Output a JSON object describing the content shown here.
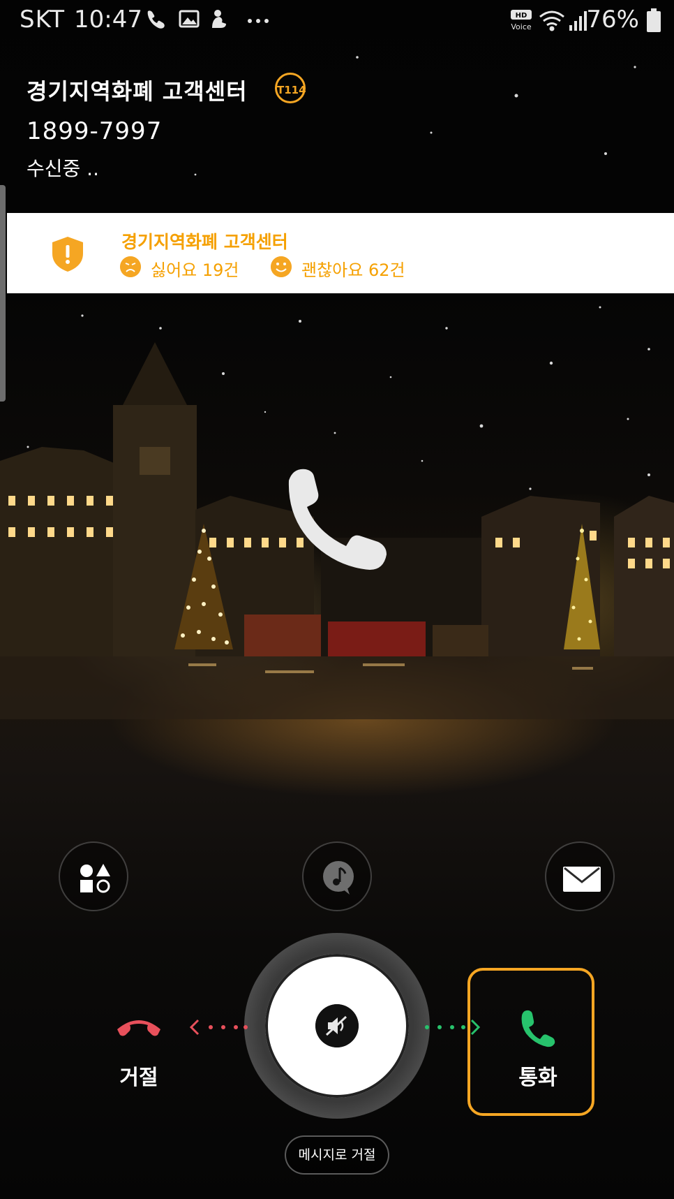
{
  "status_bar": {
    "carrier": "SKT",
    "time": "10:47",
    "battery": "76%",
    "hd_voice": "HD Voice"
  },
  "caller": {
    "name": "경기지역화폐 고객센터",
    "badge": "T114",
    "number": "1899-7997",
    "status": "수신중 .."
  },
  "info_banner": {
    "title": "경기지역화폐 고객센터",
    "dislike_label": "싫어요 19건",
    "like_label": "괜찮아요 62건"
  },
  "actions": [
    {
      "icon": "apps-shapes-icon"
    },
    {
      "icon": "music-note-icon"
    },
    {
      "icon": "message-envelope-icon"
    }
  ],
  "controls": {
    "decline_label": "거절",
    "answer_label": "통화",
    "message_decline_label": "메시지로 거절"
  },
  "colors": {
    "accent_orange": "#f5a623",
    "decline_red": "#e8505b",
    "answer_green": "#27c26c"
  }
}
